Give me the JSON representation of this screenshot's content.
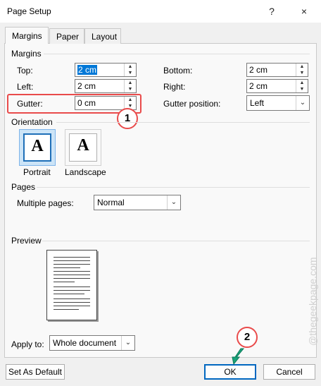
{
  "window": {
    "title": "Page Setup",
    "help": "?",
    "close": "×"
  },
  "tabs": [
    {
      "label": "Margins"
    },
    {
      "label": "Paper"
    },
    {
      "label": "Layout"
    }
  ],
  "margins": {
    "heading": "Margins",
    "top": {
      "label": "Top:",
      "value": "2 cm"
    },
    "bottom": {
      "label": "Bottom:",
      "value": "2 cm"
    },
    "left": {
      "label": "Left:",
      "value": "2 cm"
    },
    "right": {
      "label": "Right:",
      "value": "2 cm"
    },
    "gutter": {
      "label": "Gutter:",
      "value": "0 cm"
    },
    "gutter_position": {
      "label": "Gutter position:",
      "value": "Left"
    }
  },
  "orientation": {
    "heading": "Orientation",
    "portrait": {
      "label": "Portrait",
      "glyph": "A"
    },
    "landscape": {
      "label": "Landscape",
      "glyph": "A"
    }
  },
  "pages": {
    "heading": "Pages",
    "multiple_pages": {
      "label": "Multiple pages:",
      "value": "Normal"
    }
  },
  "preview": {
    "heading": "Preview"
  },
  "apply_to": {
    "label": "Apply to:",
    "value": "Whole document"
  },
  "buttons": {
    "set_default": "Set As Default",
    "ok": "OK",
    "cancel": "Cancel"
  },
  "annotations": {
    "step1": "1",
    "step2": "2"
  },
  "watermark": "@thegeekpage.com",
  "colors": {
    "accent": "#0067c0",
    "annotation_red": "#e94b4b",
    "arrow_green": "#1aa37a"
  }
}
